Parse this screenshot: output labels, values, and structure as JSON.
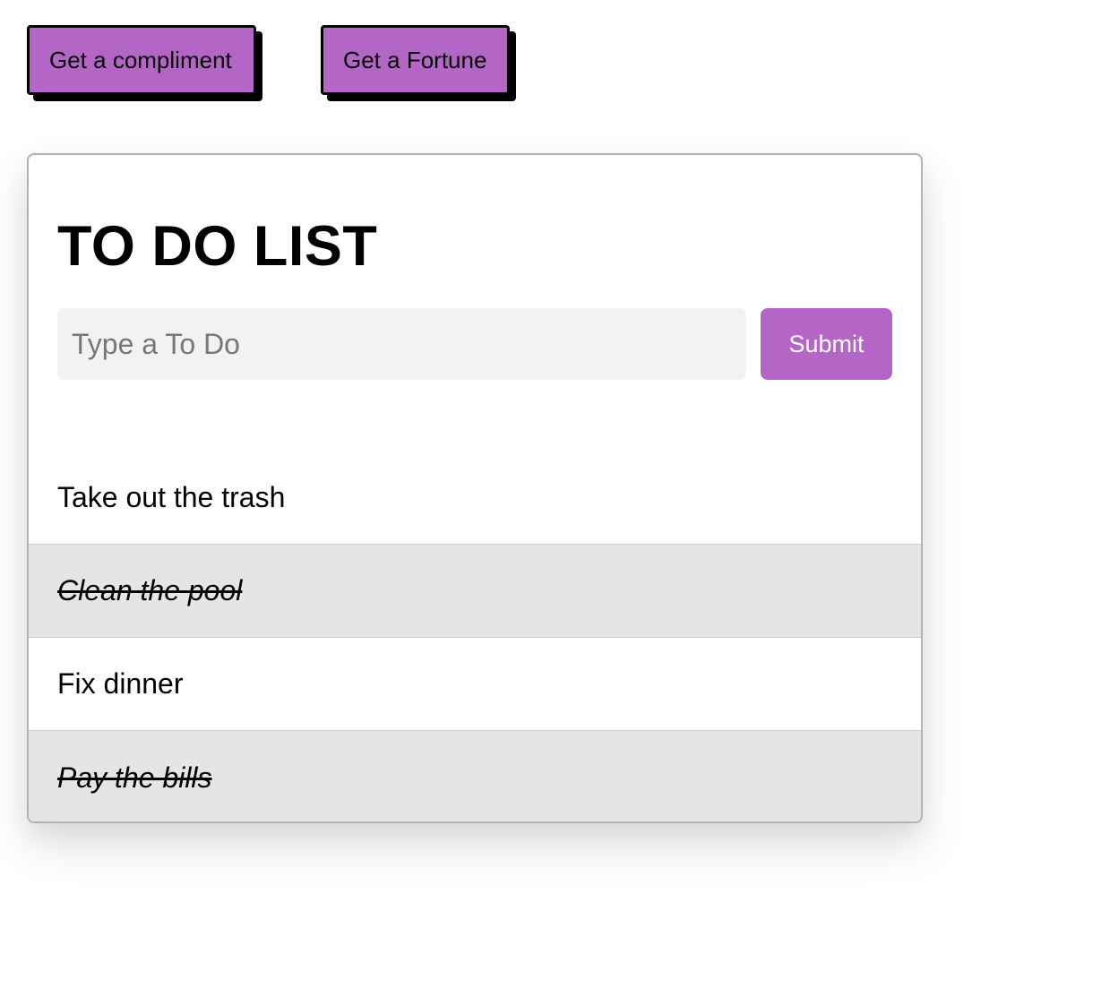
{
  "top_buttons": {
    "compliment_label": "Get a compliment",
    "fortune_label": "Get a Fortune"
  },
  "todo": {
    "title": "TO DO LIST",
    "input_placeholder": "Type a To Do",
    "input_value": "",
    "submit_label": "Submit",
    "items": [
      {
        "text": "Take out the trash",
        "completed": false
      },
      {
        "text": "Clean the pool",
        "completed": true
      },
      {
        "text": "Fix dinner",
        "completed": false
      },
      {
        "text": "Pay the bills",
        "completed": true
      }
    ]
  },
  "colors": {
    "accent": "#b366c6",
    "completed_row": "#e5e5e5",
    "input_bg": "#f2f2f2"
  }
}
